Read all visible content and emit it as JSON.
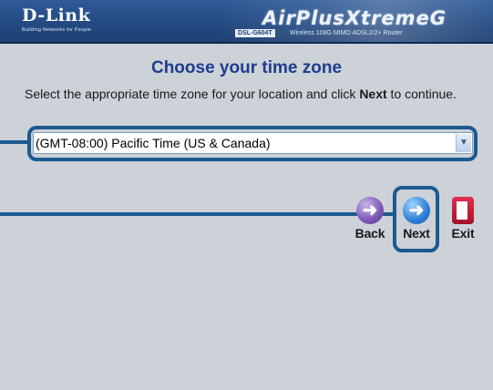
{
  "header": {
    "logo": "D-Link",
    "logo_tagline": "Building Networks for People",
    "brand": "AirPlusXtremeG",
    "model": "DSL-G604T",
    "product": "Wireless 108G MIMO ADSL2/2+ Router"
  },
  "page": {
    "title": "Choose your time zone",
    "instruction_prefix": "Select the appropriate time zone for your location and click ",
    "instruction_bold": "Next",
    "instruction_suffix": " to continue."
  },
  "timezone_select": {
    "value": "(GMT-08:00) Pacific Time (US & Canada)"
  },
  "nav": {
    "back_label": "Back",
    "next_label": "Next",
    "exit_label": "Exit"
  },
  "icons": {
    "back": "arrow-left-icon",
    "next": "arrow-right-icon",
    "exit": "door-icon",
    "dropdown": "chevron-down-icon"
  },
  "colors": {
    "header": "#234a82",
    "title": "#1f3c8f",
    "background": "#cdd1d8",
    "callout": "#1c5a8e"
  }
}
